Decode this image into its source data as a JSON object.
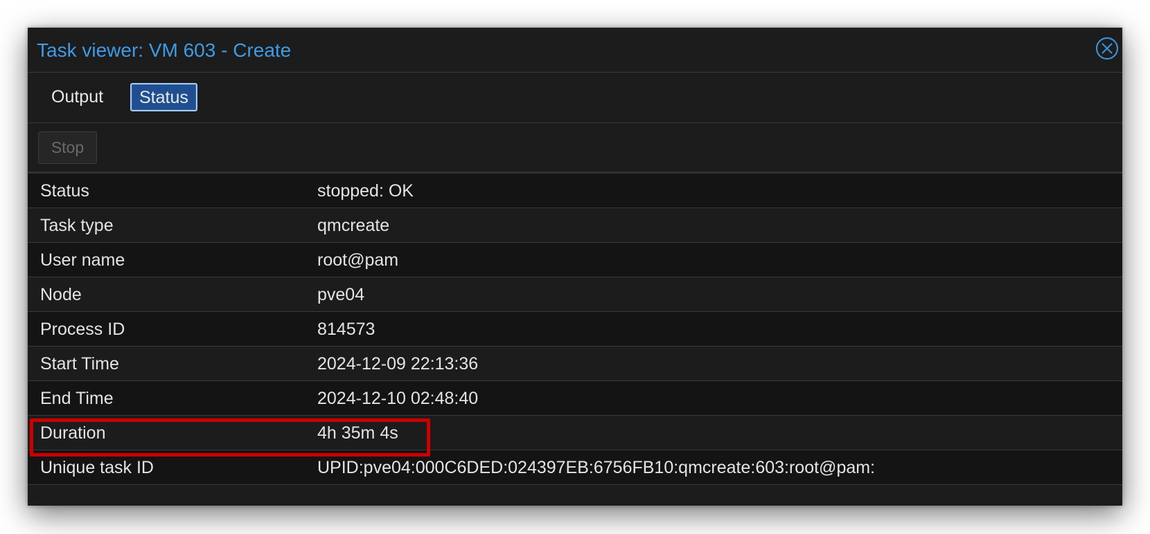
{
  "window": {
    "title": "Task viewer: VM 603 - Create",
    "close_icon": "close-circle-icon",
    "accent_color": "#3f9be6",
    "background_color": "#1c1c1c"
  },
  "tabs": [
    {
      "label": "Output",
      "active": false
    },
    {
      "label": "Status",
      "active": true
    }
  ],
  "toolbar": {
    "stop_label": "Stop",
    "stop_disabled": true
  },
  "status_grid": {
    "rows": [
      {
        "key": "Status",
        "value": "stopped: OK"
      },
      {
        "key": "Task type",
        "value": "qmcreate"
      },
      {
        "key": "User name",
        "value": "root@pam"
      },
      {
        "key": "Node",
        "value": "pve04"
      },
      {
        "key": "Process ID",
        "value": "814573"
      },
      {
        "key": "Start Time",
        "value": "2024-12-09 22:13:36"
      },
      {
        "key": "End Time",
        "value": "2024-12-10 02:48:40"
      },
      {
        "key": "Duration",
        "value": "4h 35m 4s",
        "highlighted": true
      },
      {
        "key": "Unique task ID",
        "value": "UPID:pve04:000C6DED:024397EB:6756FB10:qmcreate:603:root@pam:"
      }
    ]
  },
  "highlight_color": "#cc0000"
}
